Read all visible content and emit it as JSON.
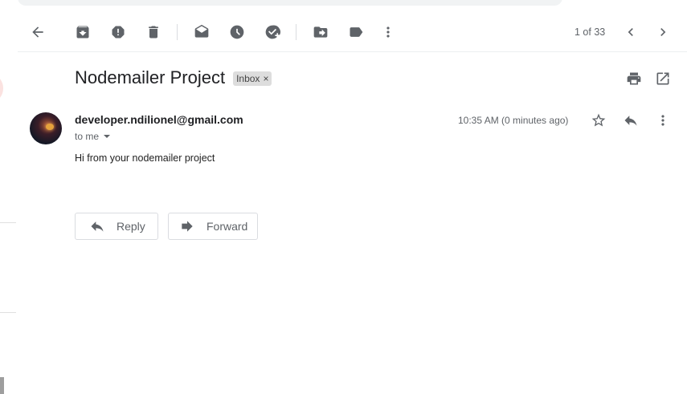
{
  "toolbar": {
    "icons": [
      "back-arrow-icon",
      "archive-icon",
      "report-spam-icon",
      "delete-icon",
      "mark-unread-icon",
      "snooze-icon",
      "add-to-tasks-icon",
      "move-to-icon",
      "labels-icon",
      "more-vert-icon"
    ],
    "pager": "1 of 33"
  },
  "email": {
    "subject": "Nodemailer Project",
    "label": "Inbox",
    "label_remove": "×",
    "sender": "developer.ndilionel@gmail.com",
    "recipient": "to me",
    "timestamp": "10:35 AM (0 minutes ago)",
    "body": "Hi from your nodemailer project"
  },
  "actions": {
    "reply_label": "Reply",
    "forward_label": "Forward"
  },
  "colors": {
    "icon": "#5f6368",
    "text": "#202124",
    "chip": "#dddddd"
  }
}
